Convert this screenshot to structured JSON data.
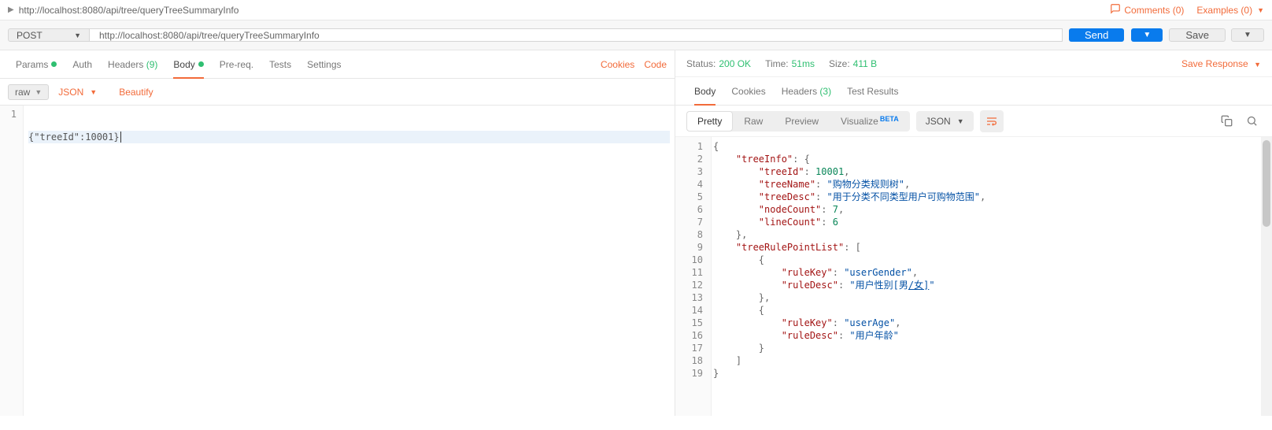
{
  "top": {
    "title": "http://localhost:8080/api/tree/queryTreeSummaryInfo",
    "comments_label": "Comments (0)",
    "examples_label": "Examples (0)"
  },
  "request": {
    "method": "POST",
    "url": "http://localhost:8080/api/tree/queryTreeSummaryInfo",
    "send_label": "Send",
    "save_label": "Save",
    "tabs": {
      "params": "Params",
      "auth": "Auth",
      "headers": "Headers",
      "headers_count": "(9)",
      "body": "Body",
      "pre": "Pre-req.",
      "tests": "Tests",
      "settings": "Settings"
    },
    "cookies_link": "Cookies",
    "code_link": "Code",
    "sub": {
      "raw": "raw",
      "json": "JSON",
      "beautify": "Beautify"
    },
    "body_text": "{\"treeId\":10001}"
  },
  "response": {
    "status_label": "Status:",
    "status_value": "200 OK",
    "time_label": "Time:",
    "time_value": "51ms",
    "size_label": "Size:",
    "size_value": "411 B",
    "save_response": "Save Response",
    "tabs": {
      "body": "Body",
      "cookies": "Cookies",
      "headers": "Headers",
      "headers_count": "(3)",
      "tests": "Test Results"
    },
    "view": {
      "pretty": "Pretty",
      "raw": "Raw",
      "preview": "Preview",
      "visualize": "Visualize",
      "beta": "BETA",
      "json": "JSON"
    },
    "body_json": {
      "treeInfo": {
        "treeId": 10001,
        "treeName": "购物分类规则树",
        "treeDesc": "用于分类不同类型用户可购物范围",
        "nodeCount": 7,
        "lineCount": 6
      },
      "treeRulePointList": [
        {
          "ruleKey": "userGender",
          "ruleDesc": "用户性别[男/女]"
        },
        {
          "ruleKey": "userAge",
          "ruleDesc": "用户年龄"
        }
      ]
    }
  }
}
